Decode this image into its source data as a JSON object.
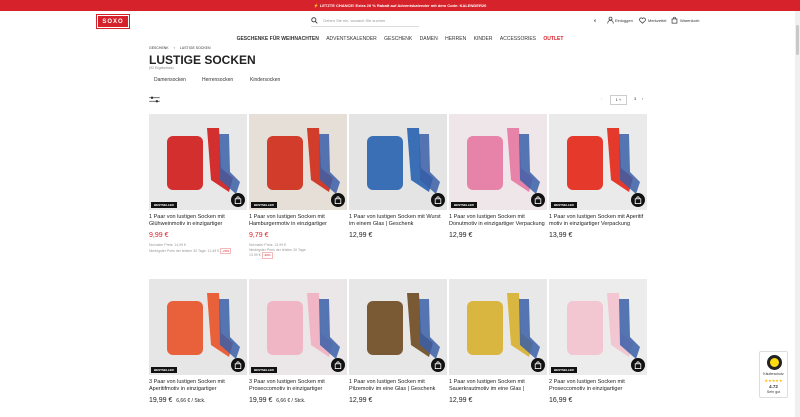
{
  "promo": "⚡ LETZTE CHANCE! Extra 20 % Rabatt auf Adventskalender mit dem Code: KALENDER20",
  "logo": "SOXO",
  "search": {
    "placeholder": "Geben Sie ein, wonach Sie suchen"
  },
  "header": {
    "currency": "€",
    "login": "Einloggen",
    "wishlist": "Merkzettel",
    "cart": "Warenkorb"
  },
  "nav": [
    "GESCHENKE FÜR WEIHNACHTEN",
    "ADVENTSKALENDER",
    "GESCHENK",
    "DAMEN",
    "HERREN",
    "KINDER",
    "ACCESSORIES",
    "OUTLET"
  ],
  "breadcrumb": [
    "GESCHENK",
    "LUSTIGE SOCKEN"
  ],
  "page": {
    "title": "LUSTIGE SOCKEN",
    "subtitle": "(92 Ergebnisse)"
  },
  "subcategories": [
    "Damensocken",
    "Herrensocken",
    "Kindersocken"
  ],
  "pager": {
    "current": "1",
    "total": "3"
  },
  "products": [
    {
      "name": "1 Paar von lustigen Socken mit Glühweinmotiv in einzigartiger Verpackung",
      "price": "9,99 €",
      "sale": true,
      "badge": "BESTSELLER",
      "normal": "Normaler Preis: 14,99 €",
      "lowest": "Niedrigster Preis der letzten 30 Tage: 12,49 €",
      "pct": "-20%",
      "bg": "#e8e8e8",
      "obj": "#d42f2f"
    },
    {
      "name": "1 Paar von lustigen Socken mit Hamburgermotiv in einzigartiger Verpackung",
      "price": "9,79 €",
      "sale": true,
      "badge": "BESTSELLER",
      "normal": "Normaler Preis: 13,99 €",
      "lowest": "Niedrigster Preis der letzten 30 Tage:",
      "lowest2": "13,99 €",
      "pct": "-30%",
      "bg": "#e5dfd8",
      "obj": "#d23c2a"
    },
    {
      "name": "1 Paar von lustigen Socken mit Wurst im einem Glas | Geschenk",
      "price": "12,99 €",
      "sale": false,
      "badge": "",
      "bg": "#e4e4e4",
      "obj": "#3a6fb5"
    },
    {
      "name": "1 Paar von lustigen Socken mit Donutmotiv in einzigartiger Verpackung",
      "price": "12,99 €",
      "sale": false,
      "badge": "BESTSELLER",
      "bg": "#efe6ea",
      "obj": "#e782a8"
    },
    {
      "name": "1 Paar von lustigen Socken mit Aperitif motiv in einzigartiger Verpackung",
      "price": "13,99 €",
      "sale": false,
      "badge": "BESTSELLER",
      "bg": "#eaeaea",
      "obj": "#e5392c"
    },
    {
      "name": "3 Paar von lustigen Socken mit Aperitifmotiv in einzigartiger Verpackung",
      "price": "19,99 €",
      "unitprice": "6,66 € / Stck.",
      "sale": false,
      "badge": "BESTSELLER",
      "bg": "#e6e6e6",
      "obj": "#e8613b"
    },
    {
      "name": "3 Paar von lustigen Socken mit Proseccomotiv in einzigartiger Verpackung",
      "price": "19,99 €",
      "unitprice": "6,66 € / Stck.",
      "sale": false,
      "badge": "BESTSELLER",
      "bg": "#ebe6e8",
      "obj": "#f0b6c6"
    },
    {
      "name": "1 Paar von lustigen Socken mit Pilzemotiv im eine Glas | Geschenk",
      "price": "12,99 €",
      "sale": false,
      "badge": "",
      "bg": "#e7e7e7",
      "obj": "#7a5a35"
    },
    {
      "name": "1 Paar von lustigen Socken mit Sauerkrautmotiv im eine Glas | Geschenk",
      "price": "12,99 €",
      "sale": false,
      "badge": "",
      "bg": "#e8e8e8",
      "obj": "#d9b640"
    },
    {
      "name": "2 Paar von lustigen Socken mit Proseccomotiv in einzigartiger Verpackung",
      "price": "16,99 €",
      "sale": false,
      "badge": "BESTSELLER",
      "bg": "#ececec",
      "obj": "#f2c7d2"
    }
  ],
  "trusted": {
    "label": "Käuferschutz",
    "stars": "★★★★★",
    "score": "4.72",
    "rating": "Sehr gut"
  }
}
